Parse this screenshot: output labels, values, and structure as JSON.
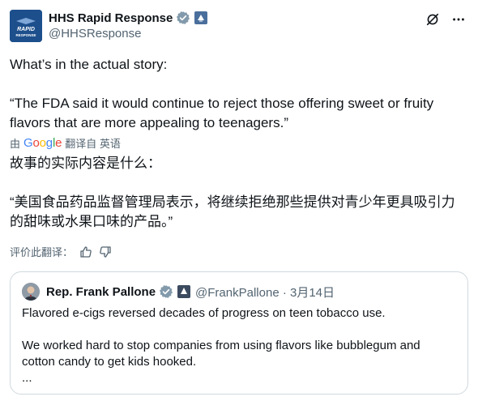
{
  "tweet": {
    "author_name": "HHS Rapid Response",
    "author_handle": "@HHSResponse",
    "avatar_text": "RAPID RESPONSE",
    "text_line1": "What’s in the actual story:",
    "text_quote": "“The FDA said it would continue to reject those offering sweet or fruity flavors that are more appealing to teenagers.”",
    "translated_prefix": "由",
    "translated_suffix": "翻译自 英语",
    "translation_line1": "故事的实际内容是什么：",
    "translation_quote": "“美国食品药品监督管理局表示，将继续拒绝那些提供对青少年更具吸引力的甜味或水果口味的产品。”",
    "rate_translation": "评价此翻译："
  },
  "icons": {
    "verified": "verified-badge-icon",
    "government": "government-badge-icon",
    "grok": "grok-icon",
    "more": "more-icon",
    "thumbs_up": "thumbs-up-icon",
    "thumbs_down": "thumbs-down-icon"
  },
  "quoted": {
    "author_name": "Rep. Frank Pallone",
    "author_handle": "@FrankPallone · 3月14日",
    "line1": "Flavored e-cigs reversed decades of progress on teen tobacco use.",
    "line2": "We worked hard to stop companies from using flavors like bubblegum and cotton candy to get kids hooked.",
    "line3": "..."
  },
  "colors": {
    "text": "#0f1419",
    "secondary": "#536471",
    "verified": "#829aab",
    "border": "#cfd9de",
    "avatar_bg": "#1d4f8c"
  }
}
